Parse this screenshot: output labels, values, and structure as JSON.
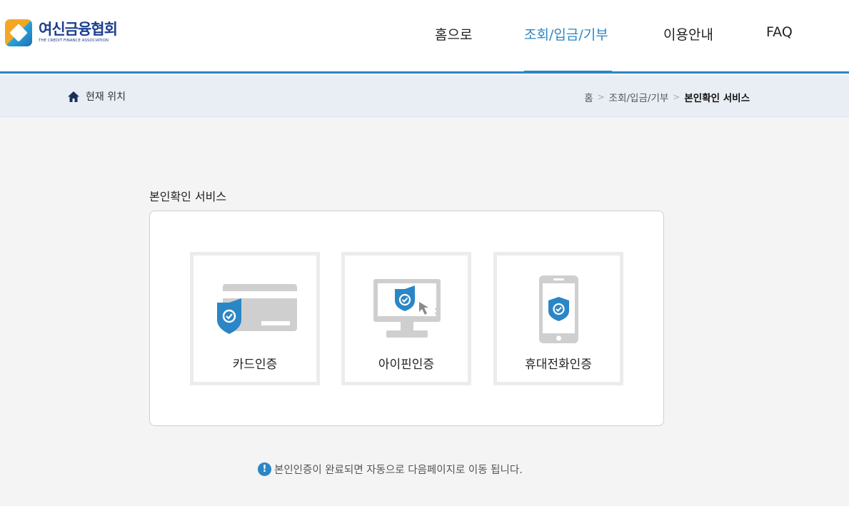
{
  "logo": {
    "name_ko": "여신금융협회",
    "name_en": "THE CREDIT FINANCE ASSOCIATION"
  },
  "nav": {
    "items": [
      {
        "label": "홈으로"
      },
      {
        "label": "조회/입금/기부",
        "active": true
      },
      {
        "label": "이용안내"
      },
      {
        "label": "FAQ"
      }
    ]
  },
  "location": {
    "label": "현재 위치",
    "crumbs": [
      "홈",
      "조회/입금/기부",
      "본인확인 서비스"
    ]
  },
  "main": {
    "title": "본인확인 서비스",
    "options": [
      {
        "label": "카드인증",
        "icon": "card-shield-icon"
      },
      {
        "label": "아이핀인증",
        "icon": "monitor-shield-icon"
      },
      {
        "label": "휴대전화인증",
        "icon": "phone-shield-icon"
      }
    ],
    "notice_icon": "!",
    "notice": "본인인증이 완료되면 자동으로 다음페이지로 이동 됩니다."
  },
  "colors": {
    "accent": "#2b86c6",
    "brand": "#1c3f8f",
    "icon_gray": "#cfcfcf"
  }
}
